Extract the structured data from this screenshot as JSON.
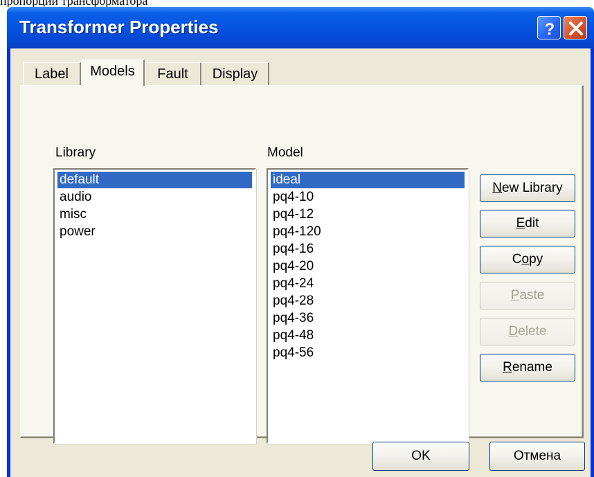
{
  "caption_fragment": "пропорции трансформатора",
  "window": {
    "title": "Transformer Properties",
    "help_glyph": "?"
  },
  "tabs": [
    {
      "label": "Label",
      "active": false
    },
    {
      "label": "Models",
      "active": true
    },
    {
      "label": "Fault",
      "active": false
    },
    {
      "label": "Display",
      "active": false
    }
  ],
  "library": {
    "label": "Library",
    "items": [
      "default",
      "audio",
      "misc",
      "power"
    ],
    "selected": "default"
  },
  "model": {
    "label": "Model",
    "items": [
      "ideal",
      "pq4-10",
      "pq4-12",
      "pq4-120",
      "pq4-16",
      "pq4-20",
      "pq4-24",
      "pq4-28",
      "pq4-36",
      "pq4-48",
      "pq4-56"
    ],
    "selected": "ideal"
  },
  "buttons": {
    "new_library": {
      "mnemonic": "N",
      "rest": "ew Library",
      "enabled": true
    },
    "edit": {
      "mnemonic": "E",
      "rest": "dit",
      "enabled": true
    },
    "copy": {
      "before": "C",
      "mnemonic": "o",
      "rest": "py",
      "enabled": true
    },
    "paste": {
      "mnemonic": "P",
      "rest": "aste",
      "enabled": false
    },
    "delete": {
      "mnemonic": "D",
      "rest": "elete",
      "enabled": false
    },
    "rename": {
      "mnemonic": "R",
      "rest": "ename",
      "enabled": true
    }
  },
  "footer": {
    "ok": "OK",
    "cancel": "Отмена"
  },
  "colors": {
    "selection": "#316ac5",
    "titlebar": "#0553e0",
    "dialog_face": "#ece9d8"
  }
}
